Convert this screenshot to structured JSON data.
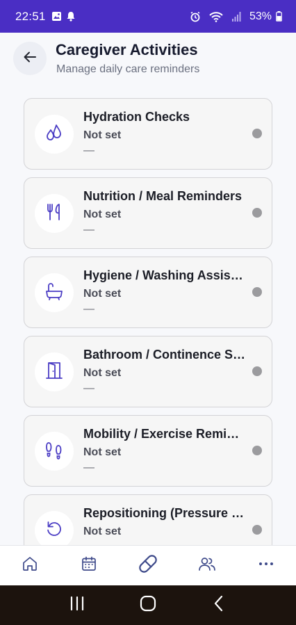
{
  "status_bar": {
    "time": "22:51",
    "battery": "53%",
    "icons": [
      "image-icon",
      "notification-bell-icon",
      "alarm-icon",
      "wifi-icon",
      "signal-icon",
      "battery-icon"
    ]
  },
  "header": {
    "title": "Caregiver Activities",
    "subtitle": "Manage daily care reminders"
  },
  "activities": [
    {
      "name": "Hydration Checks",
      "status": "Not set",
      "time": "—",
      "icon": "water-drops-icon"
    },
    {
      "name": "Nutrition / Meal Reminders",
      "status": "Not set",
      "time": "—",
      "icon": "fork-knife-icon"
    },
    {
      "name": "Hygiene / Washing Assistance",
      "status": "Not set",
      "time": "—",
      "icon": "bathtub-icon"
    },
    {
      "name": "Bathroom / Continence Support",
      "status": "Not set",
      "time": "—",
      "icon": "door-icon"
    },
    {
      "name": "Mobility / Exercise Reminders",
      "status": "Not set",
      "time": "—",
      "icon": "footprints-icon"
    },
    {
      "name": "Repositioning (Pressure Care)",
      "status": "Not set",
      "time": "—",
      "icon": "rotate-icon"
    }
  ],
  "bottom_nav": [
    "home-icon",
    "calendar-icon",
    "pill-icon",
    "people-icon",
    "more-icon"
  ],
  "colors": {
    "accent": "#4a3cc4",
    "status_bar": "#4a2ec4",
    "status_dot": "#9b9b9e"
  }
}
